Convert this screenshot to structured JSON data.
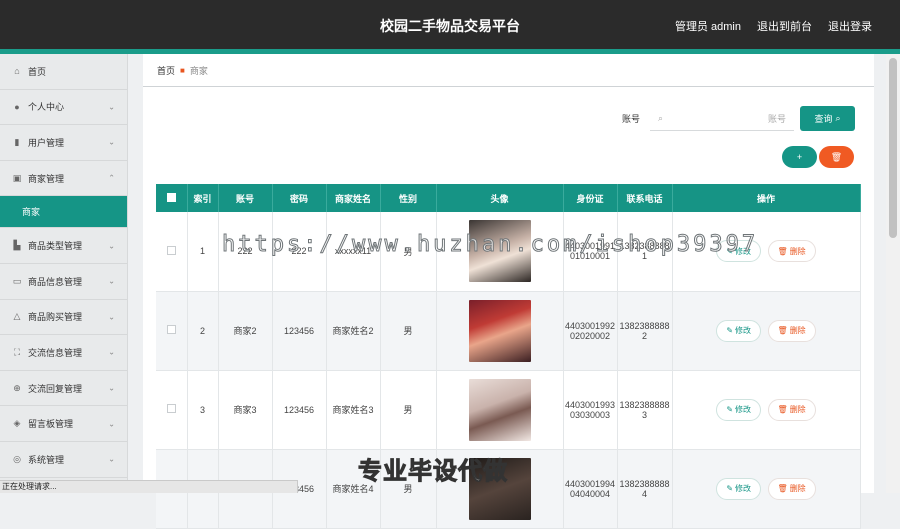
{
  "topbar": {
    "title": "校园二手物品交易平台",
    "admin_label": "管理员 admin",
    "frontend_link": "退出到前台",
    "logout_link": "退出登录"
  },
  "sidebar": {
    "items": [
      {
        "label": "首页",
        "icon": "home-icon"
      },
      {
        "label": "个人中心",
        "icon": "user-icon"
      },
      {
        "label": "用户管理",
        "icon": "bar-chart-icon"
      },
      {
        "label": "商家管理",
        "icon": "clipboard-icon"
      },
      {
        "label": "商家",
        "icon": ""
      },
      {
        "label": "商品类型管理",
        "icon": "building-icon"
      },
      {
        "label": "商品信息管理",
        "icon": "monitor-icon"
      },
      {
        "label": "商品购买管理",
        "icon": "bell-icon"
      },
      {
        "label": "交流信息管理",
        "icon": "frame-icon"
      },
      {
        "label": "交流回复管理",
        "icon": "target-icon"
      },
      {
        "label": "留言板管理",
        "icon": "shield-icon"
      },
      {
        "label": "系统管理",
        "icon": "compass-icon"
      }
    ]
  },
  "breadcrumb": {
    "home": "首页",
    "current": "商家"
  },
  "search": {
    "label": "账号",
    "placeholder": "账号",
    "button": "查询"
  },
  "actions": {
    "add": "+",
    "delete": "🗑"
  },
  "table": {
    "headers": [
      "索引",
      "账号",
      "密码",
      "商家姓名",
      "性别",
      "头像",
      "身份证",
      "联系电话",
      "操作"
    ],
    "rows": [
      {
        "index": "1",
        "account": "222",
        "password": "222",
        "name": "xxxxxx11",
        "gender": "男",
        "idcard": "440300199101010001",
        "phone": "13823888881"
      },
      {
        "index": "2",
        "account": "商家2",
        "password": "123456",
        "name": "商家姓名2",
        "gender": "男",
        "idcard": "440300199202020002",
        "phone": "13823888882"
      },
      {
        "index": "3",
        "account": "商家3",
        "password": "123456",
        "name": "商家姓名3",
        "gender": "男",
        "idcard": "440300199303030003",
        "phone": "13823888883"
      },
      {
        "index": "4",
        "account": "商家4",
        "password": "123456",
        "name": "商家姓名4",
        "gender": "男",
        "idcard": "440300199404040004",
        "phone": "13823888884"
      }
    ],
    "edit_label": "修改",
    "delete_label": "删除"
  },
  "statusbar": "正在处理请求...",
  "watermark": "https://www.huzhan.com/ishop39397",
  "promo": "专业毕设代做",
  "colors": {
    "accent": "#159586",
    "danger": "#f05a23",
    "topbar": "#2b2b2b"
  }
}
